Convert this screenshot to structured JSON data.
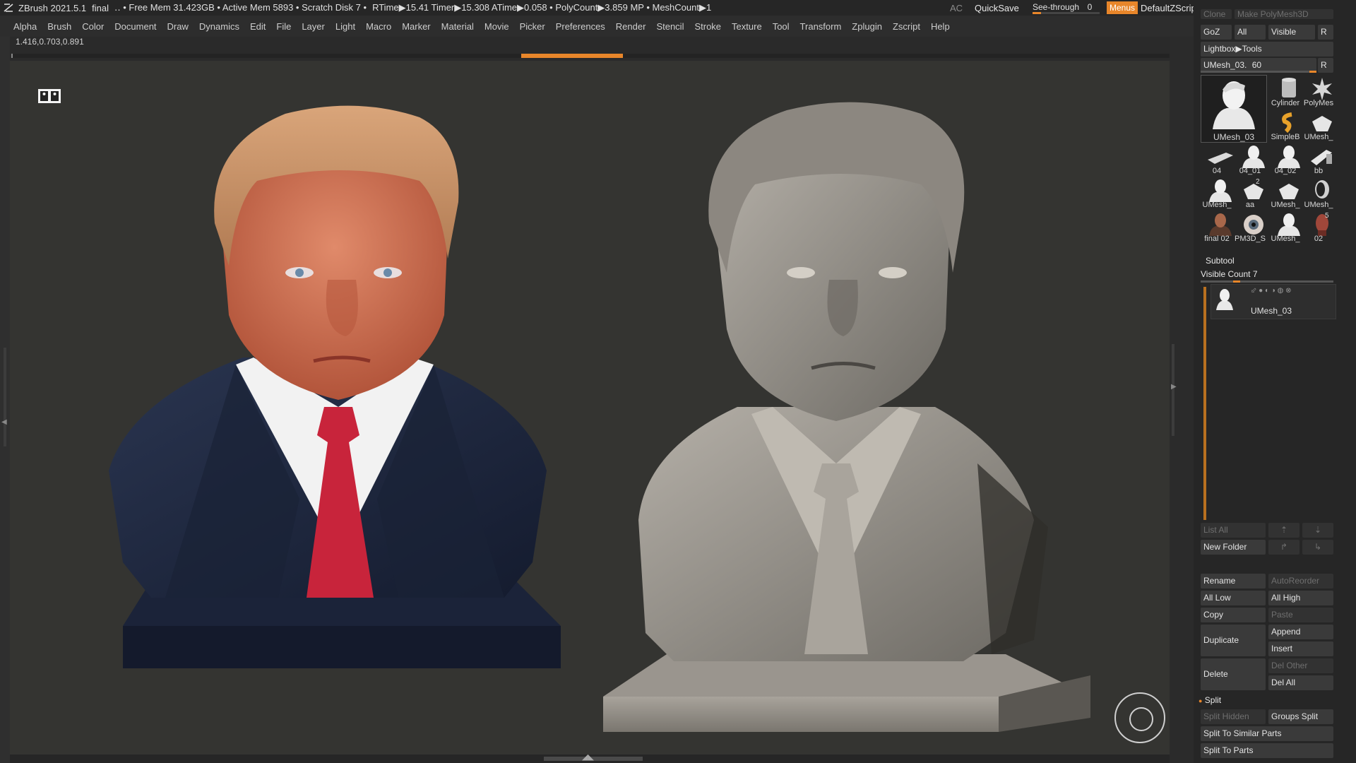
{
  "titlebar": {
    "app": "ZBrush 2021.5.1",
    "doc": "final",
    "stats": "‥ • Free Mem 31.423GB • Active Mem 5893 • Scratch Disk 7 •",
    "times": "RTime▶15.41 Timer▶15.308 ATime▶0.058 • PolyCount▶3.859 MP • MeshCount▶1",
    "ac": "AC",
    "quicksave": "QuickSave",
    "see_through_label": "See-through",
    "see_through_value": "0",
    "see_through_fraction": 0,
    "menus": "Menus",
    "default_zscript": "DefaultZScript"
  },
  "menubar": {
    "items": [
      "Alpha",
      "Brush",
      "Color",
      "Document",
      "Draw",
      "Dynamics",
      "Edit",
      "File",
      "Layer",
      "Light",
      "Macro",
      "Marker",
      "Material",
      "Movie",
      "Picker",
      "Preferences",
      "Render",
      "Stencil",
      "Stroke",
      "Texture",
      "Tool",
      "Transform",
      "Zplugin",
      "Zscript",
      "Help"
    ]
  },
  "coords": "1.416,0.703,0.891",
  "tool_panel": {
    "top_clipped_left": "Clone",
    "top_clipped_right": "Make PolyMesh3D",
    "goz": "GoZ",
    "all": "All",
    "visible": "Visible",
    "r": "R",
    "lightbox_tools": "Lightbox▶Tools",
    "current_tool": "UMesh_03.",
    "current_tool_value": "60",
    "thumbs": [
      {
        "cap": "UMesh_03",
        "icon": "bust-icon"
      },
      {
        "cap": "Cylinder",
        "icon": "cylinder-icon"
      },
      {
        "cap": "PolyMes",
        "icon": "star-icon"
      },
      {
        "cap": "SimpleB",
        "icon": "simplebrush-icon"
      },
      {
        "cap": "UMesh_",
        "icon": "mesh-icon"
      },
      {
        "cap": "04",
        "icon": "plane-icon"
      },
      {
        "cap": "04_01",
        "icon": "bust-icon"
      },
      {
        "cap": "04_02",
        "icon": "bust-icon"
      },
      {
        "cap": "bb",
        "icon": "bb-icon"
      },
      {
        "cap": "UMesh_",
        "icon": "bust-icon"
      },
      {
        "cap": "aa",
        "icon": "mesh-icon"
      },
      {
        "cap": "UMesh_",
        "icon": "mesh-icon"
      },
      {
        "cap": "UMesh_",
        "icon": "head-icon"
      },
      {
        "cap": "final 02",
        "icon": "bust-color-icon"
      },
      {
        "cap": "PM3D_S",
        "icon": "eye-icon"
      },
      {
        "cap": "UMesh_",
        "icon": "bust-icon"
      },
      {
        "cap": "02",
        "icon": "head-color-icon"
      }
    ],
    "thumb_badges": [
      "2",
      "5"
    ]
  },
  "subtool": {
    "title": "Subtool",
    "visible_count": "Visible Count 7",
    "item_name": "UMesh_03",
    "list_all": "List All",
    "new_folder": "New Folder",
    "rename": "Rename",
    "auto_reorder": "AutoReorder",
    "all_low": "All Low",
    "all_high": "All High",
    "copy": "Copy",
    "paste": "Paste",
    "duplicate": "Duplicate",
    "append": "Append",
    "insert": "Insert",
    "delete": "Delete",
    "del_other": "Del Other",
    "del_all": "Del All",
    "split": "Split",
    "split_hidden": "Split Hidden",
    "groups_split": "Groups Split",
    "split_similar": "Split To Similar Parts",
    "split_parts": "Split To Parts"
  },
  "colors": {
    "accent": "#e8862a",
    "panel": "#262626",
    "canvas": "#343431"
  }
}
